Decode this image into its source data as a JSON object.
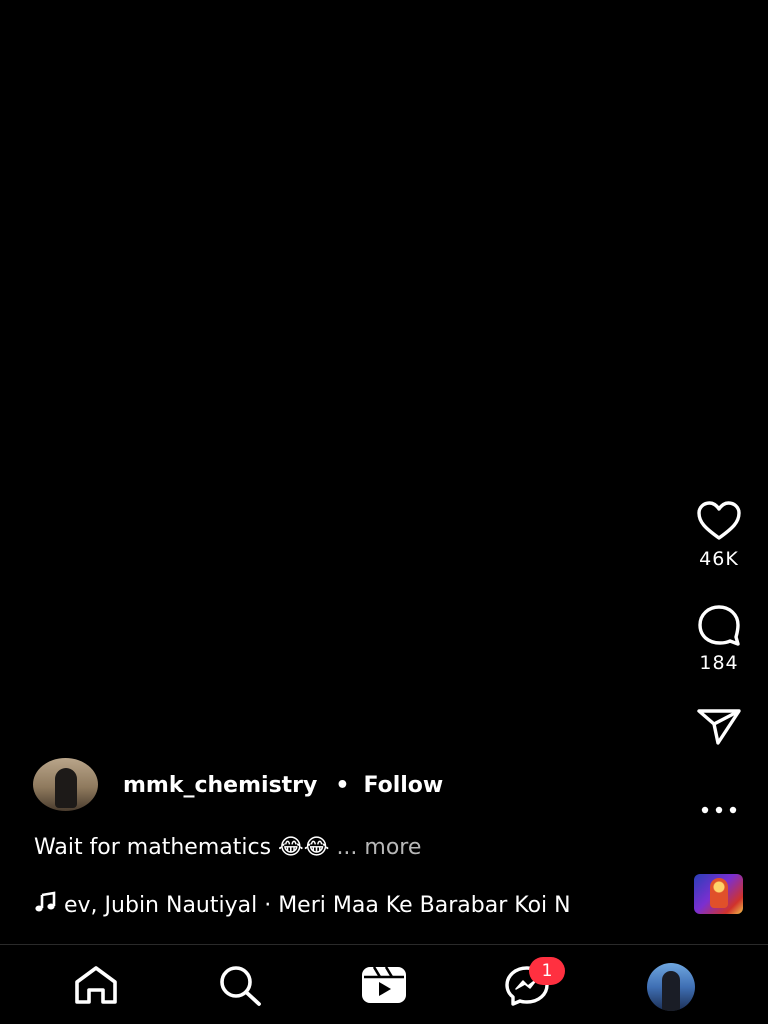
{
  "post": {
    "author": "mmk_chemistry",
    "separator": "•",
    "follow_label": "Follow",
    "caption_text": "Wait for mathematics 😂😂",
    "caption_more": "... more",
    "audio_text": "ev, Jubin Nautiyal · Meri Maa Ke Barabar Koi N"
  },
  "actions": {
    "likes": "46K",
    "comments": "184"
  },
  "nav": {
    "items": [
      "home",
      "search",
      "reels",
      "messages",
      "profile"
    ],
    "messages_badge": "1"
  },
  "colors": {
    "background": "#000000",
    "text": "#ffffff",
    "muted": "#b8b8b8",
    "badge": "#ff3040"
  },
  "icons": [
    "heart-icon",
    "comment-icon",
    "share-icon",
    "more-icon",
    "music-note-icon",
    "home-icon",
    "search-icon",
    "reels-icon",
    "messenger-icon"
  ]
}
